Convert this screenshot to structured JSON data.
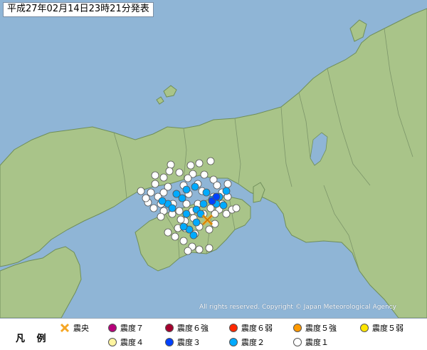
{
  "header": {
    "title": "平成27年02月14日23時21分発表"
  },
  "copyright": "All rights reserved. Copyright © Japan Meteorological Agency",
  "colors": {
    "sea": "#8fb5d6",
    "land": "#a9c489",
    "land_stroke": "#6f8e5a",
    "pref_border": "#7c9569",
    "epicenter": "#f5a623"
  },
  "legend": {
    "title": "凡 例",
    "epicenter_label": "震央",
    "items": [
      {
        "label": "震度７",
        "color": "#b6007b",
        "icon": "intensity-7-dot"
      },
      {
        "label": "震度６強",
        "color": "#a5002d",
        "icon": "intensity-6-strong-dot"
      },
      {
        "label": "震度６弱",
        "color": "#ff2800",
        "icon": "intensity-6-weak-dot"
      },
      {
        "label": "震度５強",
        "color": "#ff9900",
        "icon": "intensity-5-strong-dot"
      },
      {
        "label": "震度５弱",
        "color": "#ffe600",
        "icon": "intensity-5-weak-dot"
      },
      {
        "label": "震度４",
        "color": "#fff5a0",
        "icon": "intensity-4-dot"
      },
      {
        "label": "震度３",
        "color": "#0041ff",
        "icon": "intensity-3-dot"
      },
      {
        "label": "震度２",
        "color": "#00aaff",
        "icon": "intensity-2-dot"
      },
      {
        "label": "震度１",
        "color": "#ffffff",
        "icon": "intensity-1-dot"
      }
    ]
  },
  "markers": {
    "intensity_3": "#0041ff",
    "intensity_2": "#00aaff",
    "intensity_1": "#ffffff",
    "counts_note": "observation stations shown as dots"
  }
}
